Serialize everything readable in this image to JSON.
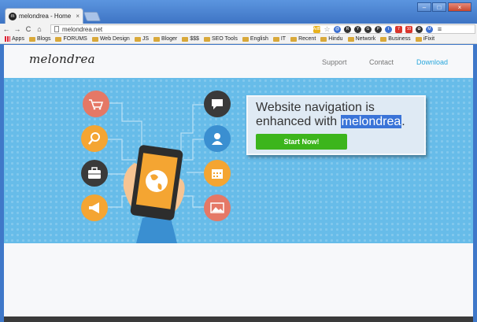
{
  "browser": {
    "tab_title": "melondrea - Home",
    "tab_close": "×",
    "url": "melondrea.net",
    "window_controls": {
      "minimize": "–",
      "maximize": "□",
      "close": "×"
    },
    "nav": {
      "back": "←",
      "forward": "→",
      "reload": "C",
      "home": "⌂"
    },
    "extensions": [
      "AdB",
      "☆",
      "@",
      "R",
      "Y",
      "G",
      "P",
      "t",
      "7",
      "10",
      "✿",
      "M",
      "≡"
    ]
  },
  "bookmarks": [
    {
      "label": "Apps",
      "icon": "apps-icon"
    },
    {
      "label": "Blogs",
      "icon": "folder-icon"
    },
    {
      "label": "FORUMS",
      "icon": "folder-icon"
    },
    {
      "label": "Web Design",
      "icon": "folder-icon"
    },
    {
      "label": "JS",
      "icon": "folder-icon"
    },
    {
      "label": "Bloger",
      "icon": "folder-icon"
    },
    {
      "label": "$$$",
      "icon": "folder-icon"
    },
    {
      "label": "SEO Tools",
      "icon": "folder-icon"
    },
    {
      "label": "English",
      "icon": "folder-icon"
    },
    {
      "label": "IT",
      "icon": "folder-icon"
    },
    {
      "label": "Recent",
      "icon": "folder-icon"
    },
    {
      "label": "Hindu",
      "icon": "folder-icon"
    },
    {
      "label": "Network",
      "icon": "folder-icon"
    },
    {
      "label": "Business",
      "icon": "folder-icon"
    },
    {
      "label": "iFixit",
      "icon": "ifixit-icon"
    }
  ],
  "site": {
    "logo": "melondrea",
    "nav": {
      "support": "Support",
      "contact": "Contact",
      "download": "Download"
    },
    "hero": {
      "headline_line1": "Website navigation is",
      "headline_line2_prefix": "enhanced with ",
      "headline_highlight": "melondrea",
      "headline_suffix": ".",
      "cta": "Start Now!"
    }
  },
  "colors": {
    "accent": "#2aa7dc",
    "hero_bg": "#67bce9",
    "cta_green": "#3cb51c",
    "highlight": "#3a74d8"
  }
}
